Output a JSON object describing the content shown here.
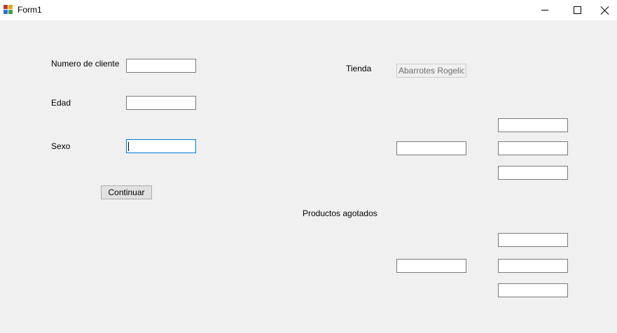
{
  "window": {
    "title": "Form1",
    "app_icon": "winforms-app-icon",
    "controls": [
      "minimize-icon",
      "maximize-icon",
      "close-icon"
    ]
  },
  "left_panel": {
    "client_number_label": "Numero de cliente",
    "client_number_value": "",
    "age_label": "Edad",
    "age_value": "",
    "sex_label": "Sexo",
    "sex_value": "",
    "continue_button_label": "Continuar"
  },
  "right_panel": {
    "store_label": "Tienda",
    "store_value": "Abarrotes Rogelio",
    "out_of_stock_label": "Productos agotados",
    "group1": {
      "main_value": "",
      "items": [
        "",
        "",
        ""
      ]
    },
    "group2": {
      "main_value": "",
      "items": [
        "",
        "",
        ""
      ]
    }
  },
  "colors": {
    "window_bg": "#f0f0f0",
    "titlebar_bg": "#ffffff",
    "focus_border": "#0078d7",
    "input_border": "#7a7a7a",
    "disabled_border": "#cccccc",
    "disabled_text": "#6d6d6d"
  }
}
